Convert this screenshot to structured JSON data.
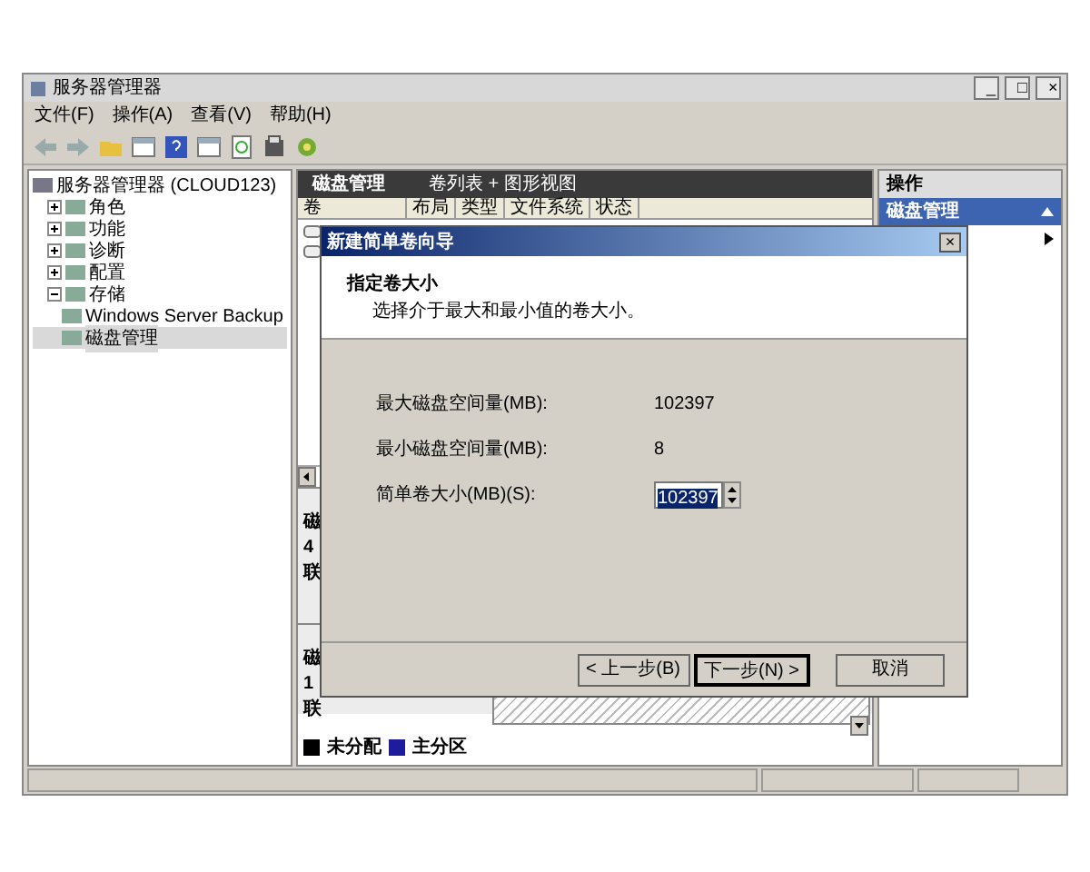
{
  "window": {
    "title": "服务器管理器",
    "controls": [
      "_",
      "□",
      "×"
    ]
  },
  "menu": [
    "文件(F)",
    "操作(A)",
    "查看(V)",
    "帮助(H)"
  ],
  "tree": {
    "label": "服务器管理器 (CLOUD123)",
    "selected": false,
    "children": [
      {
        "label": "角色",
        "expanded": false,
        "selected": false
      },
      {
        "label": "功能",
        "expanded": false,
        "selected": false
      },
      {
        "label": "诊断",
        "expanded": false,
        "selected": false
      },
      {
        "label": "配置",
        "expanded": false,
        "selected": false
      },
      {
        "label": "存储",
        "expanded": true,
        "selected": false,
        "children": [
          {
            "label": "Windows Server Backup",
            "selected": false
          },
          {
            "label": "磁盘管理",
            "selected": true
          }
        ]
      }
    ]
  },
  "center": {
    "title": "磁盘管理",
    "view": "卷列表 + 图形视图",
    "columns": [
      "卷",
      "布局",
      "类型",
      "文件系统",
      "状态"
    ],
    "disks": [
      {
        "lines": [
          "磁",
          "4",
          "联"
        ]
      },
      {
        "lines": [
          "磁",
          "1",
          "联"
        ]
      }
    ],
    "legend": [
      {
        "label": "未分配",
        "color": "#000000"
      },
      {
        "label": "主分区",
        "color": "#1c1c9c"
      }
    ]
  },
  "actions": {
    "title": "操作",
    "items": [
      {
        "label": "磁盘管理",
        "selected": true
      }
    ]
  },
  "dialog": {
    "title": "新建简单卷向导",
    "close": "×",
    "heading": "指定卷大小",
    "subheading": "选择介于最大和最小值的卷大小。",
    "fields": [
      {
        "kind": "readout",
        "label": "最大磁盘空间量(MB):",
        "value": "102397"
      },
      {
        "kind": "readout",
        "label": "最小磁盘空间量(MB):",
        "value": "8"
      },
      {
        "kind": "spinner",
        "label": "简单卷大小(MB)(S):",
        "value": "102397"
      }
    ],
    "buttons": [
      {
        "label": "< 上一步(B)",
        "default": false
      },
      {
        "label": "下一步(N) >",
        "default": true
      },
      {
        "label": "取消",
        "default": false
      }
    ]
  }
}
